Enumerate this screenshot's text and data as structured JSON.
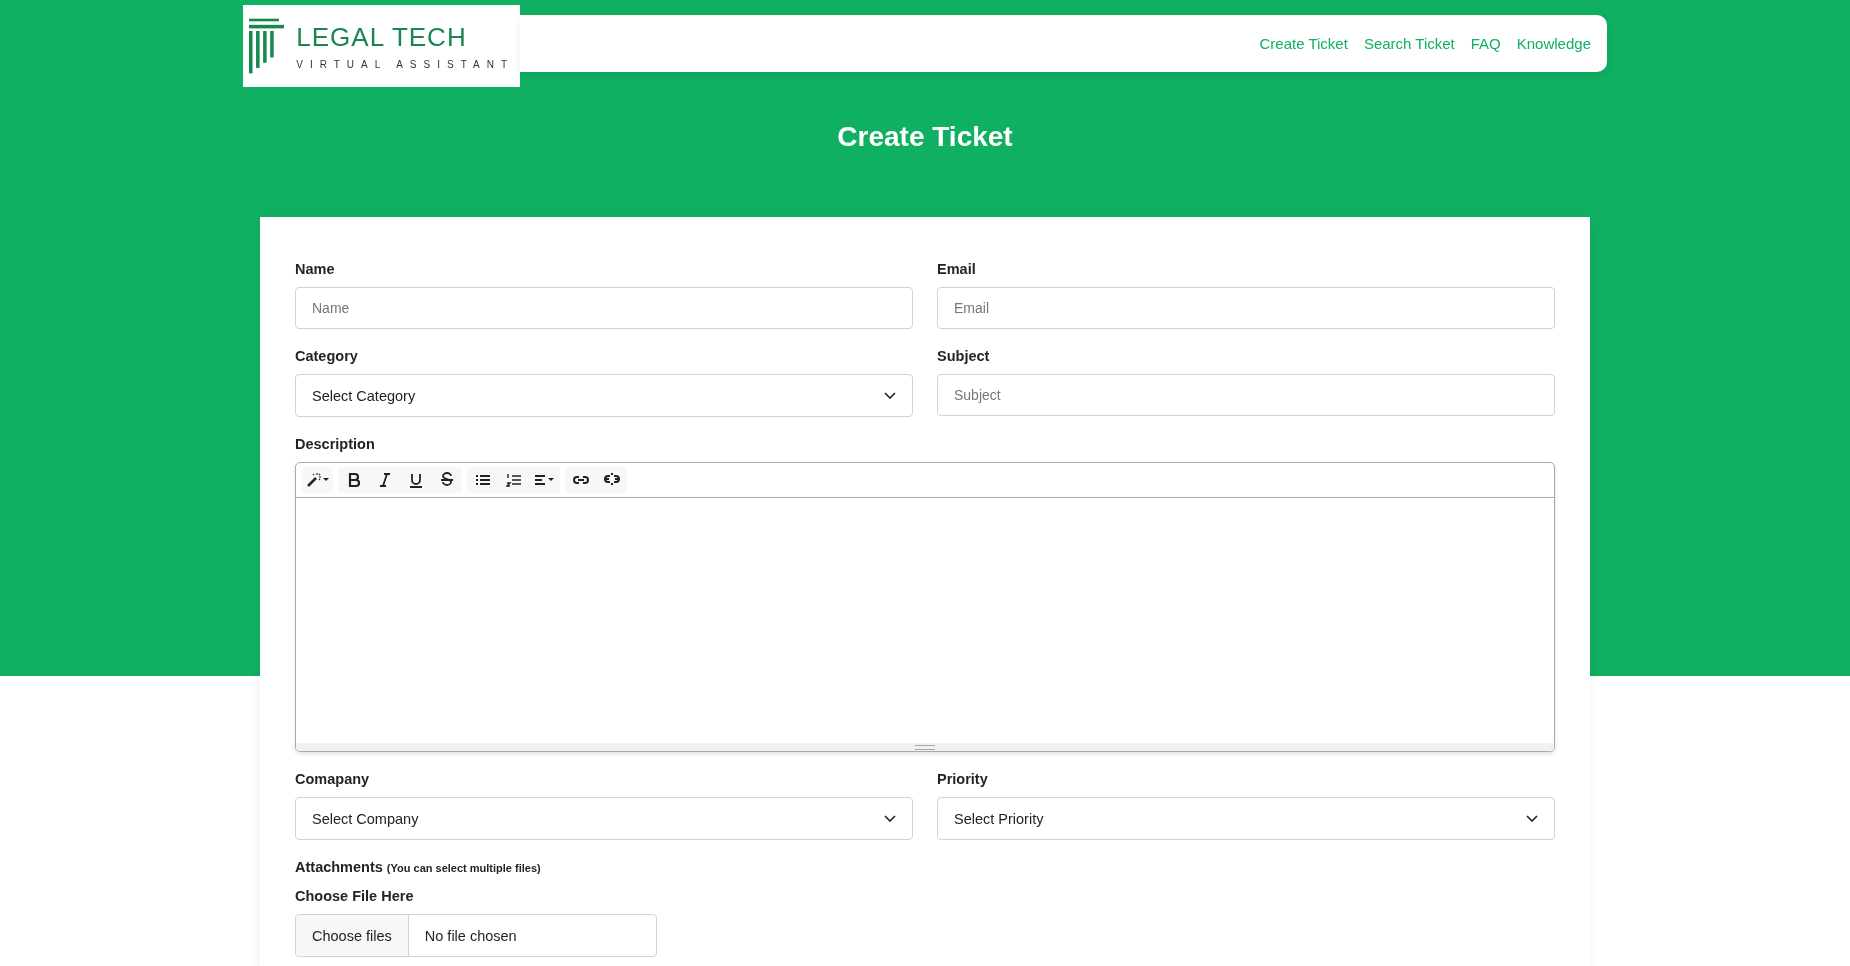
{
  "logo": {
    "title": "LEGAL TECH",
    "subtitle": "VIRTUAL ASSISTANT"
  },
  "nav": [
    "Create Ticket",
    "Search Ticket",
    "FAQ",
    "Knowledge"
  ],
  "page_title": "Create Ticket",
  "rows": [
    [
      {
        "kind": "text",
        "label": "Name",
        "placeholder": "Name"
      },
      {
        "kind": "text",
        "label": "Email",
        "placeholder": "Email"
      }
    ],
    [
      {
        "kind": "select",
        "label": "Category",
        "value": "Select Category"
      },
      {
        "kind": "text",
        "label": "Subject",
        "placeholder": "Subject"
      }
    ],
    [
      {
        "kind": "editor",
        "label": "Description"
      }
    ],
    [
      {
        "kind": "select",
        "label": "Comapany",
        "value": "Select Company"
      },
      {
        "kind": "select",
        "label": "Priority",
        "value": "Select Priority"
      }
    ]
  ],
  "attachments": {
    "label": "Attachments",
    "hint": "(You can select multiple files)",
    "field_label": "Choose File Here",
    "button": "Choose files",
    "status": "No file chosen"
  }
}
